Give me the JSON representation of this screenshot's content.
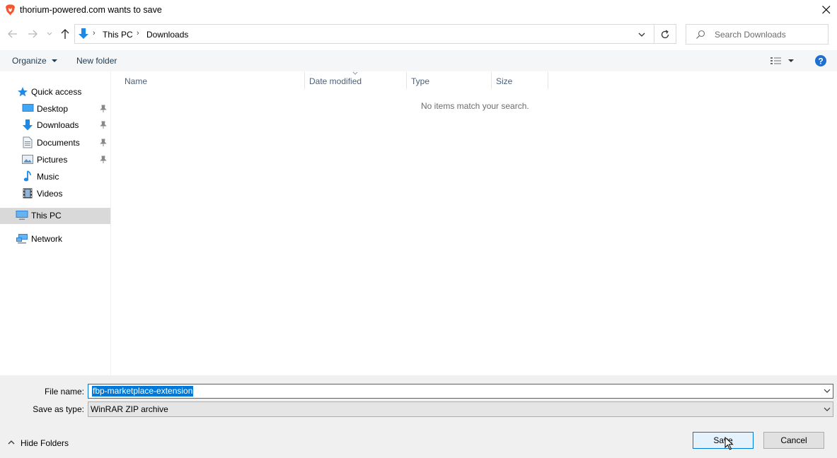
{
  "window": {
    "title": "thorium-powered.com wants to save"
  },
  "address_bar": {
    "segments": [
      "This PC",
      "Downloads"
    ]
  },
  "search": {
    "placeholder": "Search Downloads"
  },
  "toolbar": {
    "organize_label": "Organize",
    "new_folder_label": "New folder"
  },
  "nav_pane": {
    "items": [
      {
        "label": "Quick access",
        "icon": "star-icon"
      },
      {
        "label": "Desktop",
        "icon": "desktop-icon",
        "pinned": true
      },
      {
        "label": "Downloads",
        "icon": "download-arrow-icon",
        "pinned": true
      },
      {
        "label": "Documents",
        "icon": "document-icon",
        "pinned": true
      },
      {
        "label": "Pictures",
        "icon": "picture-icon",
        "pinned": true
      },
      {
        "label": "Music",
        "icon": "music-note-icon"
      },
      {
        "label": "Videos",
        "icon": "film-icon"
      },
      {
        "label": "This PC",
        "icon": "computer-icon",
        "selected": true
      },
      {
        "label": "Network",
        "icon": "network-icon"
      }
    ]
  },
  "file_list": {
    "columns": [
      "Name",
      "Date modified",
      "Type",
      "Size"
    ],
    "empty_message": "No items match your search."
  },
  "form": {
    "file_name_label": "File name:",
    "file_name_value": "fbp-marketplace-extension",
    "save_type_label": "Save as type:",
    "save_type_value": "WinRAR ZIP archive"
  },
  "buttons": {
    "save": "Save",
    "cancel": "Cancel",
    "hide_folders": "Hide Folders"
  },
  "colors": {
    "accent": "#0078d7",
    "toolbar_bg": "#f5f6f7",
    "bottom_bg": "#f0f0f0",
    "selection_bg": "#d9d9d9"
  }
}
